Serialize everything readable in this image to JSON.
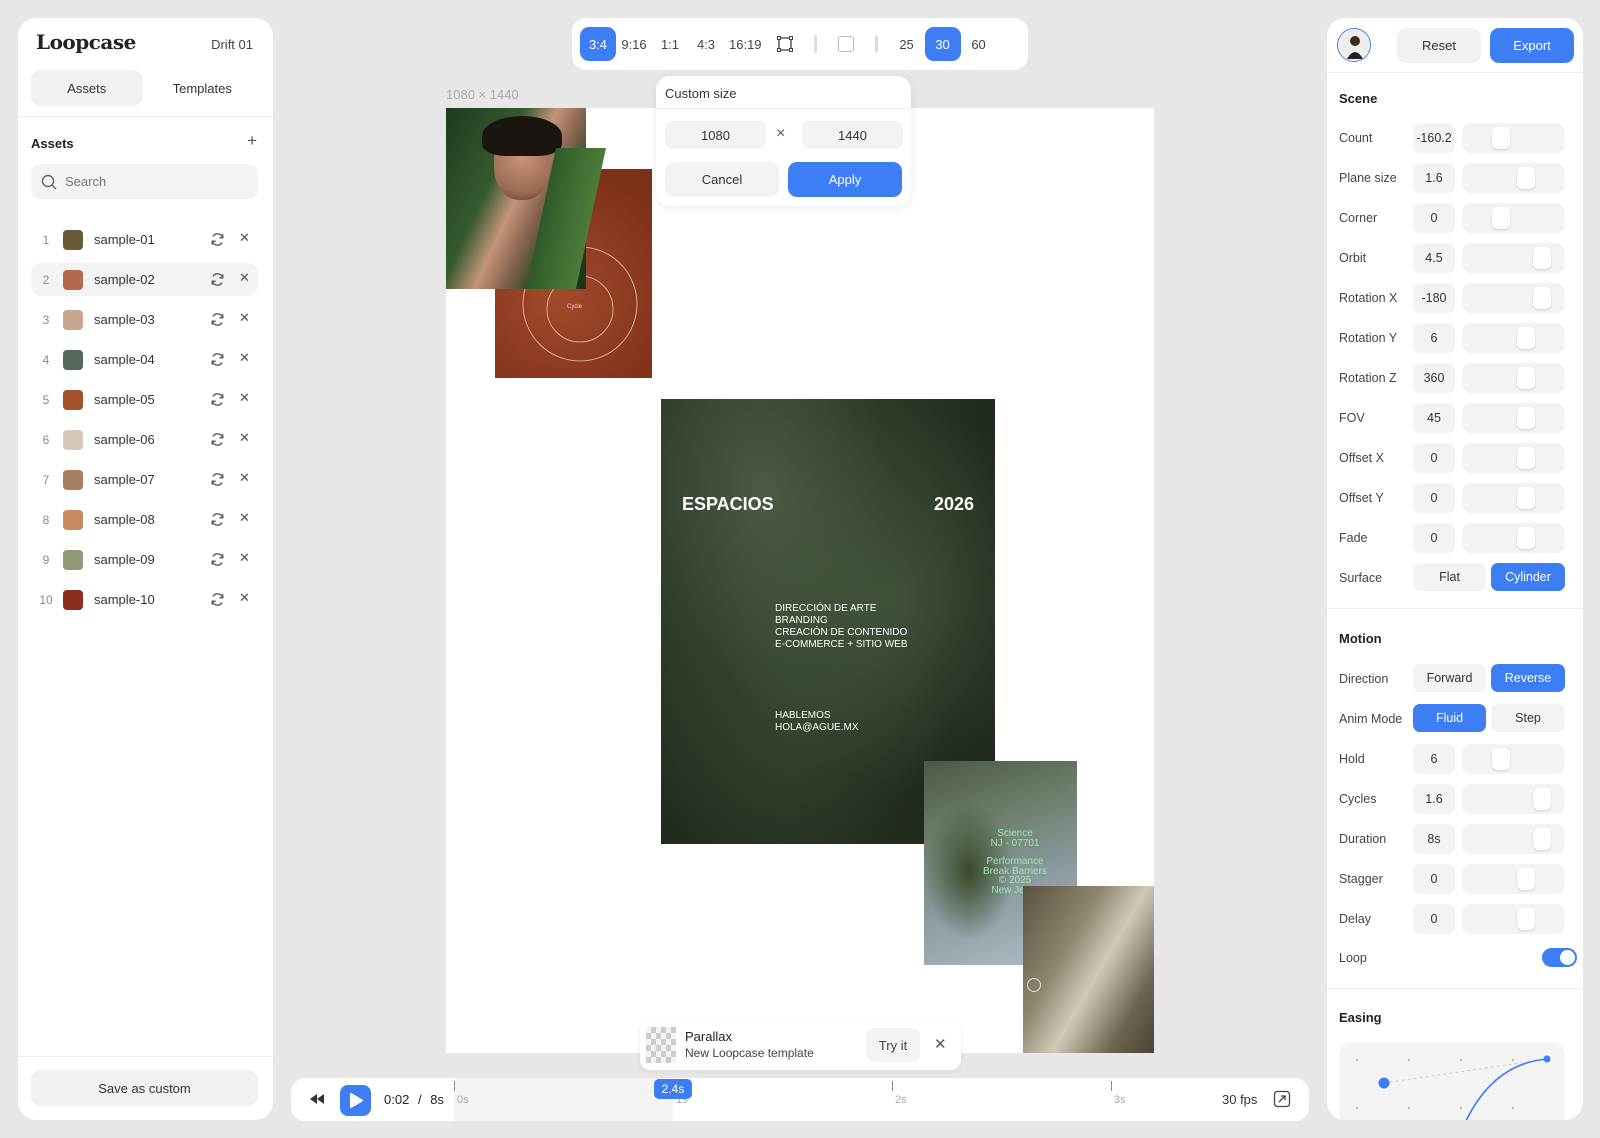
{
  "app": {
    "name": "Loopcase",
    "project": "Drift 01"
  },
  "left_tabs": [
    "Assets",
    "Templates"
  ],
  "assets_title": "Assets",
  "search": {
    "placeholder": "Search"
  },
  "assets": [
    {
      "num": "1",
      "name": "sample-01",
      "color": "#6b5a3a"
    },
    {
      "num": "2",
      "name": "sample-02",
      "color": "#b26a4a"
    },
    {
      "num": "3",
      "name": "sample-03",
      "color": "#c9a68e"
    },
    {
      "num": "4",
      "name": "sample-04",
      "color": "#55685a"
    },
    {
      "num": "5",
      "name": "sample-05",
      "color": "#a0522d"
    },
    {
      "num": "6",
      "name": "sample-06",
      "color": "#d6c8b9"
    },
    {
      "num": "7",
      "name": "sample-07",
      "color": "#a9805f"
    },
    {
      "num": "8",
      "name": "sample-08",
      "color": "#c98a60"
    },
    {
      "num": "9",
      "name": "sample-09",
      "color": "#8f9a76"
    },
    {
      "num": "10",
      "name": "sample-10",
      "color": "#8b2e1e"
    }
  ],
  "save_custom": "Save as custom",
  "ratios": [
    "3:4",
    "9:16",
    "1:1",
    "4:3",
    "16:19"
  ],
  "active_ratio": "3:4",
  "fps_options": [
    "25",
    "30",
    "60"
  ],
  "active_fps": "30",
  "canvas_size_label": "1080 × 1440",
  "custom_size": {
    "title": "Custom size",
    "width": "1080",
    "times": "×",
    "height": "1440",
    "cancel": "Cancel",
    "apply": "Apply"
  },
  "poster": {
    "title": "ESPACIOS",
    "year": "2026",
    "lines": [
      "DIRECCIÓN DE ARTE",
      "BRANDING",
      "CREACIÓN DE CONTENIDO",
      "E-COMMERCE + SITIO WEB"
    ],
    "contact": [
      "HABLEMOS",
      "HOLA@AGUE.MX"
    ]
  },
  "science_card": {
    "lines": [
      "Science",
      "NJ - 07701",
      "Performance",
      "Break Barriers",
      "© 2025",
      "New Jerse"
    ]
  },
  "cycle_label": "Cycle",
  "toast": {
    "title": "Parallax",
    "subtitle": "New Loopcase template",
    "action": "Try it"
  },
  "timeline": {
    "current": "0:02",
    "sep": "/",
    "total": "8s",
    "ticks": [
      "0s",
      "1s",
      "2s",
      "3s"
    ],
    "playhead": "2.4s",
    "progress": 0.3,
    "fps": "30 fps"
  },
  "actions": {
    "reset": "Reset",
    "export": "Export"
  },
  "scene": {
    "title": "Scene",
    "params": [
      {
        "label": "Count",
        "value": "-160.2",
        "pos": 0.38
      },
      {
        "label": "Plane size",
        "value": "1.6",
        "pos": 0.62
      },
      {
        "label": "Corner",
        "value": "0",
        "pos": 0.38
      },
      {
        "label": "Orbit",
        "value": "4.5",
        "pos": 0.78
      },
      {
        "label": "Rotation X",
        "value": "-180",
        "pos": 0.78
      },
      {
        "label": "Rotation Y",
        "value": "6",
        "pos": 0.62
      },
      {
        "label": "Rotation Z",
        "value": "360",
        "pos": 0.62
      },
      {
        "label": "FOV",
        "value": "45",
        "pos": 0.62
      },
      {
        "label": "Offset X",
        "value": "0",
        "pos": 0.62
      },
      {
        "label": "Offset Y",
        "value": "0",
        "pos": 0.62
      },
      {
        "label": "Fade",
        "value": "0",
        "pos": 0.62
      }
    ],
    "surface": {
      "label": "Surface",
      "options": [
        "Flat",
        "Cylinder"
      ],
      "selected": "Cylinder"
    }
  },
  "motion": {
    "title": "Motion",
    "direction": {
      "label": "Direction",
      "options": [
        "Forward",
        "Reverse"
      ],
      "selected": "Reverse"
    },
    "anim_mode": {
      "label": "Anim Mode",
      "options": [
        "Fluid",
        "Step"
      ],
      "selected": "Fluid"
    },
    "params": [
      {
        "label": "Hold",
        "value": "6",
        "pos": 0.38
      },
      {
        "label": "Cycles",
        "value": "1.6",
        "pos": 0.78
      },
      {
        "label": "Duration",
        "value": "8s",
        "pos": 0.78
      },
      {
        "label": "Stagger",
        "value": "0",
        "pos": 0.62
      },
      {
        "label": "Delay",
        "value": "0",
        "pos": 0.62
      }
    ],
    "loop": {
      "label": "Loop",
      "on": true
    }
  },
  "easing": {
    "title": "Easing"
  },
  "colors": {
    "accent": "#3d7ef5"
  }
}
